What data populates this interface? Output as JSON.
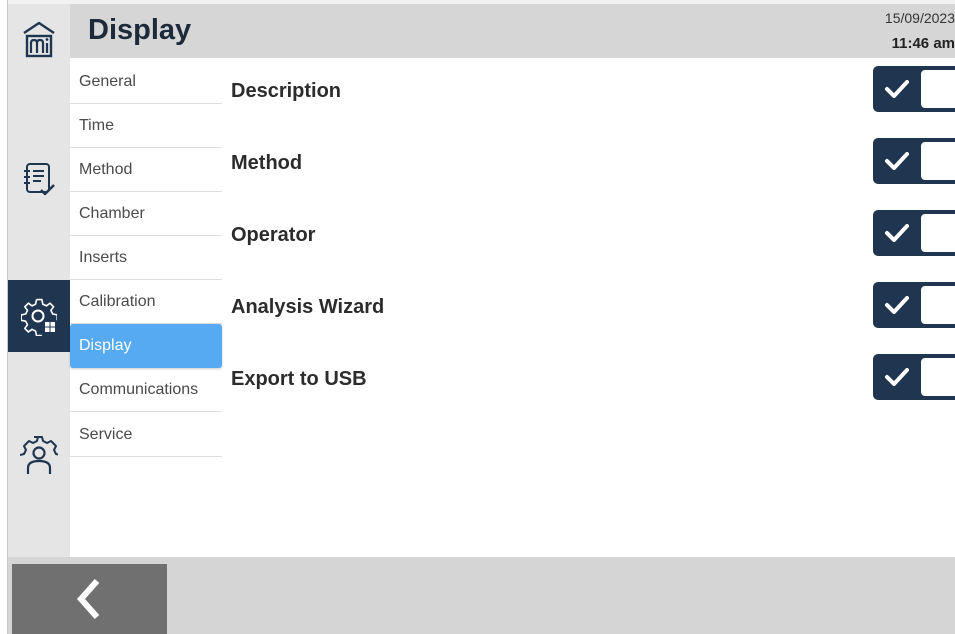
{
  "header": {
    "title": "Display",
    "date": "15/09/2023",
    "time": "11:46 am"
  },
  "rail": {
    "items": [
      {
        "icon": "home-building-icon",
        "active": false
      },
      {
        "icon": "method-checklist-icon",
        "active": false
      },
      {
        "icon": "settings-gear-icon",
        "active": true
      },
      {
        "icon": "user-gear-icon",
        "active": false
      }
    ],
    "accent_color": "#1f3550"
  },
  "submenu": {
    "items": [
      {
        "label": "General"
      },
      {
        "label": "Time"
      },
      {
        "label": "Method"
      },
      {
        "label": "Chamber"
      },
      {
        "label": "Inserts"
      },
      {
        "label": "Calibration"
      },
      {
        "label": "Display"
      },
      {
        "label": "Communications"
      },
      {
        "label": "Service"
      }
    ],
    "selected": "Display",
    "selected_color": "#56aaf1"
  },
  "settings": {
    "rows": [
      {
        "label": "Description",
        "checked": true
      },
      {
        "label": "Method",
        "checked": true
      },
      {
        "label": "Operator",
        "checked": true
      },
      {
        "label": "Analysis Wizard",
        "checked": true
      },
      {
        "label": "Export to USB",
        "checked": true
      }
    ]
  },
  "footer": {
    "back_icon": "chevron-left-icon"
  }
}
